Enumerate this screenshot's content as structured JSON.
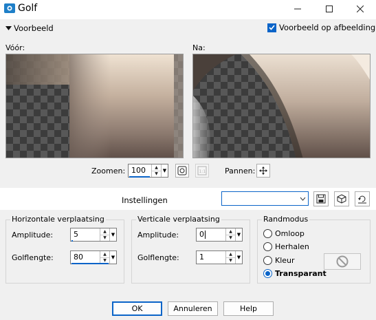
{
  "window": {
    "title": "Golf",
    "minimize_glyph": "—",
    "maximize_glyph": "☐",
    "close_glyph": "✕"
  },
  "preview_header": {
    "toggle_label": "Voorbeeld",
    "preview_on_image_label": "Voorbeeld op afbeelding",
    "preview_on_image_checked": true
  },
  "previews": {
    "before_label": "Vóór:",
    "after_label": "Na:"
  },
  "zoom": {
    "label": "Zoomen:",
    "value": "100",
    "pan_label": "Pannen:"
  },
  "settings": {
    "label": "Instellingen",
    "preset_value": ""
  },
  "horizontal": {
    "title": "Horizontale verplaatsing",
    "amplitude_label": "Amplitude:",
    "amplitude_value": "5",
    "wavelength_label": "Golflengte:",
    "wavelength_value": "80"
  },
  "vertical": {
    "title": "Verticale verplaatsing",
    "amplitude_label": "Amplitude:",
    "amplitude_value": "0",
    "wavelength_label": "Golflengte:",
    "wavelength_value": "1"
  },
  "edge_mode": {
    "title": "Randmodus",
    "options": [
      "Omloop",
      "Herhalen",
      "Kleur",
      "Transparant"
    ],
    "selected": "Transparant"
  },
  "buttons": {
    "ok": "OK",
    "cancel": "Annuleren",
    "help": "Help"
  },
  "colors": {
    "accent": "#0a64c8",
    "panel_bg": "#f0f0f0"
  }
}
